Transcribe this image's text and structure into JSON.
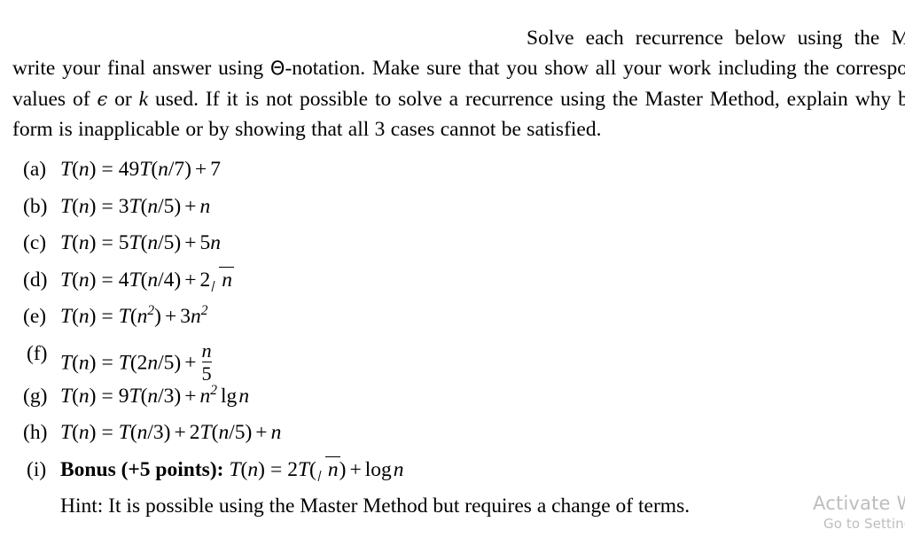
{
  "document": {
    "intro": {
      "text_before_theta": "Solve each recurrence below using the Master Method and write your final answer using ",
      "theta_symbol": "Θ",
      "text_after_theta": "-notation. Make sure that you show all your work including the corresponding case and the values of ",
      "epsilon_symbol": "ϵ",
      "text_or": " or ",
      "k_symbol": "k",
      "text_tail": " used. If it is not possible to solve a recurrence using the Master Method, explain why by showing that the form is inapplicable or by showing that all 3 cases cannot be satisfied."
    },
    "problems": [
      {
        "marker": "(a)",
        "equation_text": "T(n) = 49T(n/7) + 7",
        "lhs": "T",
        "lhs_arg": "(n)",
        "equals": "=",
        "coefficient": "49",
        "recursive_term": "T",
        "recursive_arg": "(n/7)",
        "plus": "+",
        "driving_function": "7"
      },
      {
        "marker": "(b)",
        "equation_text": "T(n) = 3T(n/5) + n",
        "lhs": "T",
        "lhs_arg": "(n)",
        "equals": "=",
        "coefficient": "3",
        "recursive_term": "T",
        "recursive_arg": "(n/5)",
        "plus": "+",
        "driving_function": "n"
      },
      {
        "marker": "(c)",
        "equation_text": "T(n) = 5T(n/5) + 5n",
        "lhs": "T",
        "lhs_arg": "(n)",
        "equals": "=",
        "coefficient": "5",
        "recursive_term": "T",
        "recursive_arg": "(n/5)",
        "plus": "+",
        "driving_function": "5n"
      },
      {
        "marker": "(d)",
        "equation_text": "T(n) = 4T(n/4) + 2√n",
        "lhs": "T",
        "lhs_arg": "(n)",
        "equals": "=",
        "coefficient": "4",
        "recursive_term": "T",
        "recursive_arg": "(n/4)",
        "plus": "+",
        "driving_coefficient": "2",
        "driving_radicand": "n"
      },
      {
        "marker": "(e)",
        "equation_text": "T(n) = T(n²) + 3n²",
        "lhs": "T",
        "lhs_arg": "(n)",
        "equals": "=",
        "recursive_term": "T",
        "recursive_arg_base": "n",
        "recursive_arg_exp": "2",
        "plus": "+",
        "driving_coefficient": "3",
        "driving_base": "n",
        "driving_exp": "2"
      },
      {
        "marker": "(f)",
        "equation_text": "T(n) = T(2n/5) + n/5",
        "lhs": "T",
        "lhs_arg": "(n)",
        "equals": "=",
        "recursive_term": "T",
        "recursive_arg": "(2n/5)",
        "plus": "+",
        "frac_numerator": "n",
        "frac_denominator": "5"
      },
      {
        "marker": "(g)",
        "equation_text": "T(n) = 9T(n/3) + n² lg n",
        "lhs": "T",
        "lhs_arg": "(n)",
        "equals": "=",
        "coefficient": "9",
        "recursive_term": "T",
        "recursive_arg": "(n/3)",
        "plus": "+",
        "driving_base": "n",
        "driving_exp": "2",
        "log_name": "lg",
        "log_arg": "n"
      },
      {
        "marker": "(h)",
        "equation_text": "T(n) = T(n/3) + 2T(n/5) + n",
        "lhs": "T",
        "lhs_arg": "(n)",
        "equals": "=",
        "recursive_term": "T",
        "recursive_arg": "(n/3)",
        "plus": "+",
        "coefficient2": "2",
        "recursive_term2": "T",
        "recursive_arg2": "(n/5)",
        "plus2": "+",
        "driving_function": "n"
      },
      {
        "marker": "(i)",
        "bonus_label": "Bonus (+5 points):",
        "equation_text": "T(n) = 2T(√n) + log n",
        "lhs": "T",
        "lhs_arg": "(n)",
        "equals": "=",
        "coefficient": "2",
        "recursive_term": "T",
        "recursive_paren_open": "(",
        "recursive_radicand": "n",
        "recursive_paren_close": ")",
        "plus": "+",
        "log_name": "log",
        "log_arg": "n",
        "hint": "Hint: It is possible using the Master Method but requires a change of terms."
      }
    ]
  },
  "watermark": {
    "title": "Activate Windows",
    "subtitle": "Go to Settings to activate Windows.",
    "color": "#bdbdbd"
  }
}
